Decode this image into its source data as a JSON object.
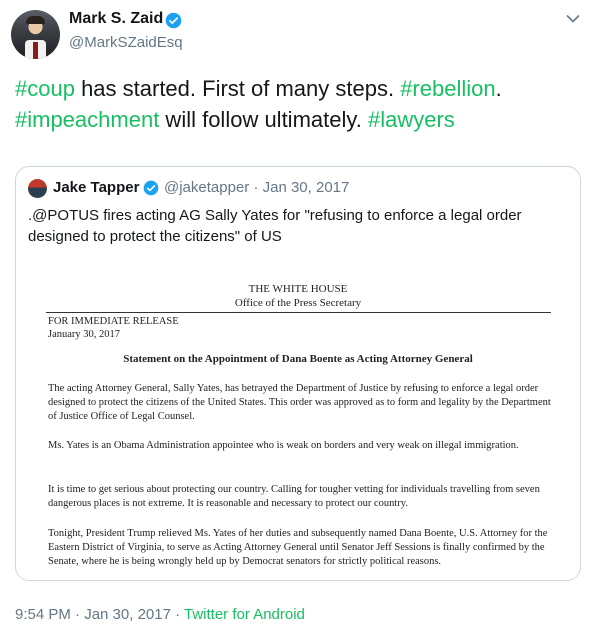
{
  "author": {
    "name": "Mark S. Zaid",
    "handle": "@MarkSZaidEsq",
    "verified": true
  },
  "tweet": {
    "segments": [
      {
        "text": "#coup",
        "hashtag": true
      },
      {
        "text": " has started. First of many steps. ",
        "hashtag": false
      },
      {
        "text": "#rebellion",
        "hashtag": true
      },
      {
        "text": ". ",
        "hashtag": false
      },
      {
        "text": "#impeachment",
        "hashtag": true
      },
      {
        "text": " will follow ultimately. ",
        "hashtag": false
      },
      {
        "text": "#lawyers",
        "hashtag": true
      }
    ]
  },
  "quoted": {
    "name": "Jake Tapper",
    "handle_date": "@jaketapper · Jan 30, 2017",
    "text": ".@POTUS fires acting AG Sally Yates  for \"refusing to enforce a legal order designed to protect the citizens\" of US",
    "document": {
      "header_line1": "THE WHITE HOUSE",
      "header_line2": "Office of the Press Secretary",
      "release": "FOR IMMEDIATE RELEASE",
      "date": "January 30, 2017",
      "heading": "Statement on the Appointment of Dana Boente as Acting Attorney General",
      "p1": "The acting Attorney General, Sally Yates, has betrayed the Department of Justice by refusing to enforce a legal order designed to protect the citizens of the United States. This order was approved as to form and legality by the Department of Justice Office of Legal Counsel.",
      "p2": "Ms. Yates is an Obama Administration appointee who is weak on borders and very weak on illegal immigration.",
      "p3": "It is time to get serious about protecting our country. Calling for tougher vetting for individuals travelling from seven dangerous places is not extreme. It is reasonable and necessary to protect our country.",
      "p4": "Tonight, President Trump relieved Ms. Yates of her duties and subsequently named Dana Boente, U.S. Attorney for the Eastern District of Virginia, to serve as Acting Attorney General until Senator Jeff Sessions is finally confirmed by the Senate, where he is being wrongly held up by Democrat senators for strictly political reasons."
    }
  },
  "footer": {
    "time_date": "9:54 PM · Jan 30, 2017 · ",
    "source": "Twitter for Android"
  },
  "colors": {
    "hashtag": "#17bf63",
    "verified": "#1da1f2",
    "muted": "#657786",
    "border": "#ccd6dd"
  },
  "icons": [
    "verified-badge-icon",
    "chevron-down-icon"
  ]
}
